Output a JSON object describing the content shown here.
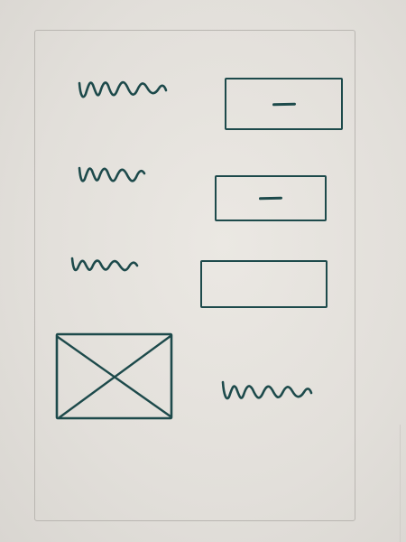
{
  "form": {
    "rows": [
      {
        "label_icon": "squiggle-text-placeholder-icon",
        "field_value": ""
      },
      {
        "label_icon": "squiggle-text-placeholder-icon",
        "field_value": ""
      },
      {
        "label_icon": "squiggle-text-placeholder-icon",
        "field_value": ""
      }
    ],
    "image": {
      "icon": "image-placeholder-icon"
    },
    "caption_icon": "squiggle-text-placeholder-icon"
  },
  "colors": {
    "ink": "#1d4a4b",
    "paper": "#e4e1dc",
    "frame": "#b9b6b1"
  }
}
